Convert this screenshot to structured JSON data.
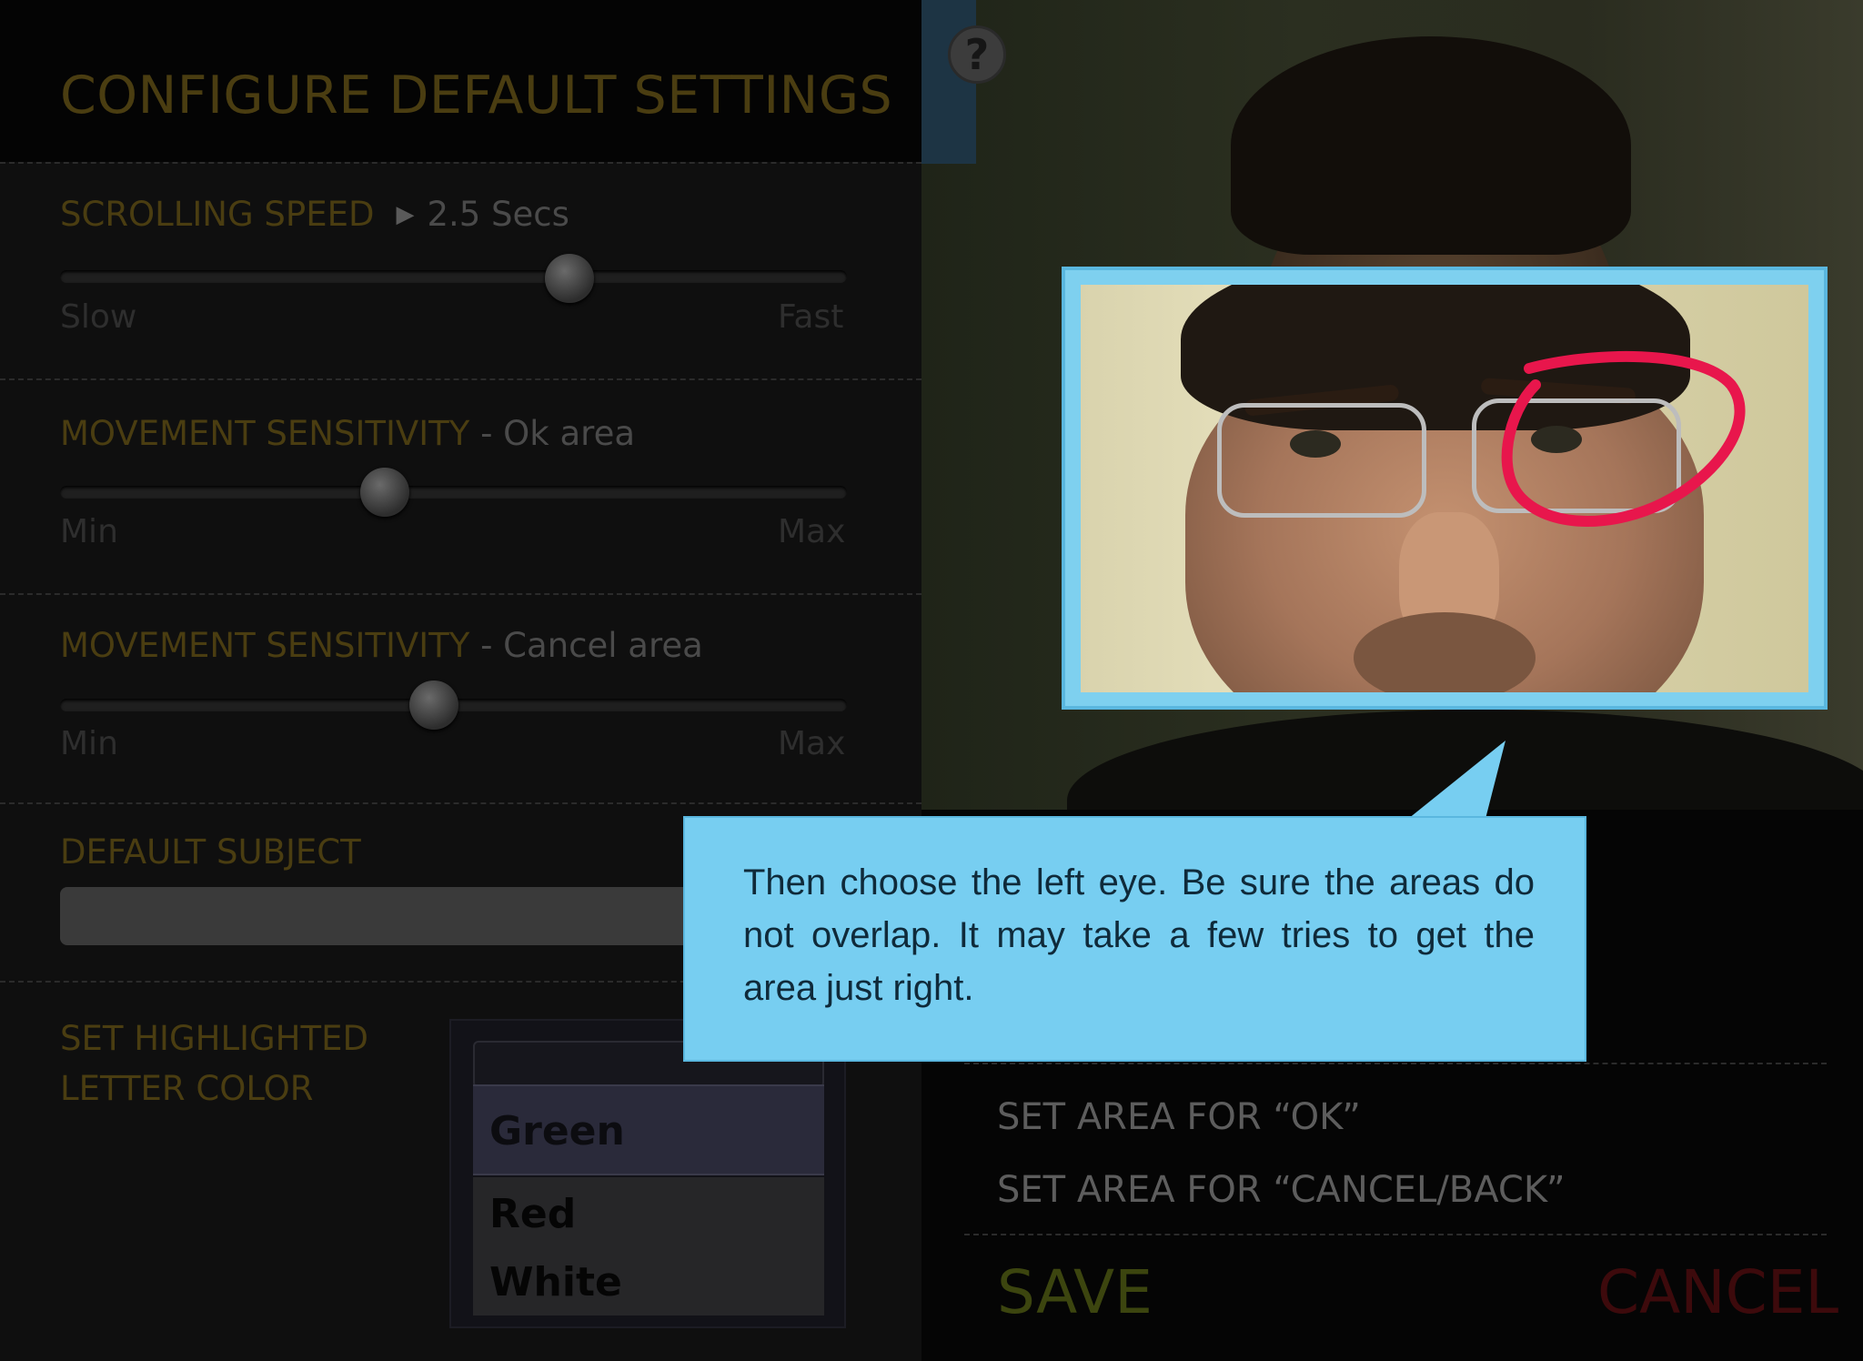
{
  "settings": {
    "title": "CONFIGURE DEFAULT SETTINGS",
    "scrolling_speed": {
      "label": "SCROLLING SPEED",
      "value": "2.5 Secs",
      "min_label": "Slow",
      "max_label": "Fast",
      "slider_level": 0.65
    },
    "movement_ok": {
      "label": "MOVEMENT SENSITIVITY",
      "suffix": " - Ok area",
      "min_label": "Min",
      "max_label": "Max",
      "slider_level": 0.41
    },
    "movement_cancel": {
      "label": "MOVEMENT SENSITIVITY",
      "suffix": " - Cancel area",
      "min_label": "Min",
      "max_label": "Max",
      "slider_level": 0.47
    },
    "default_subject": {
      "label": "DEFAULT SUBJECT",
      "value": ""
    },
    "highlight_color": {
      "label_line1": "SET HIGHLIGHTED",
      "label_line2": "LETTER COLOR",
      "options": [
        "Green",
        "Red",
        "White"
      ],
      "selected": "Green"
    }
  },
  "camera": {
    "help_label": "?",
    "tooltip": "Then choose the left eye. Be sure the areas do not overlap.  It may take a few tries to get the area just right.",
    "set_ok": "SET AREA FOR “OK”",
    "set_cancel": "SET AREA FOR “CANCEL/BACK”",
    "save": "SAVE",
    "cancel": "CANCEL"
  },
  "colors": {
    "accent_gold": "#4a3d11",
    "tooltip_blue": "#77cef1",
    "circle_red": "#e8164c",
    "save_green": "#3c450f",
    "cancel_red": "#3d0a0c"
  },
  "icons": [
    "help-icon",
    "play-icon"
  ]
}
